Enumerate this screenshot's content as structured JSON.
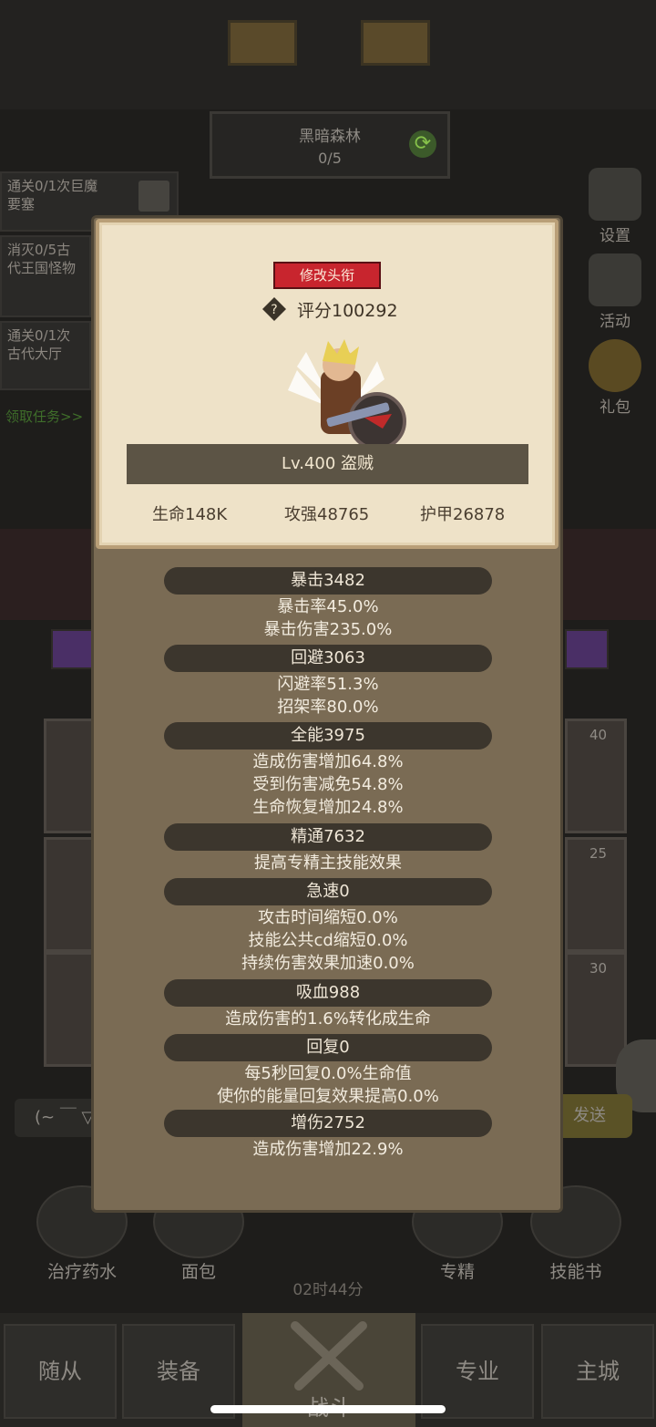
{
  "stage": {
    "name": "黑暗森林",
    "progress": "0/5"
  },
  "quests": [
    {
      "text": "通关0/1次巨魔要塞"
    },
    {
      "text": "消灭0/5古代王国怪物"
    },
    {
      "text": "通关0/1次古代大厅"
    }
  ],
  "quest_link": "领取任务>>",
  "side_menu": [
    {
      "label": "设置",
      "icon": "gear-icon"
    },
    {
      "label": "活动",
      "icon": "activity-icon"
    },
    {
      "label": "礼包",
      "icon": "gift-icon"
    }
  ],
  "card_numbers": [
    "40",
    "25",
    "30"
  ],
  "chat_placeholder": "(~ ￣ ▽",
  "send_label": "发送",
  "items": [
    {
      "label": "治疗药水",
      "icon": "potion-icon"
    },
    {
      "label": "面包",
      "icon": "bread-icon"
    },
    {
      "label": "专精",
      "icon": "specialization-icon"
    },
    {
      "label": "技能书",
      "icon": "skillbook-icon"
    }
  ],
  "timer": "02时44分",
  "tabs": [
    {
      "label": "随从"
    },
    {
      "label": "装备"
    },
    {
      "label": "战斗"
    },
    {
      "label": "专业"
    },
    {
      "label": "主城"
    }
  ],
  "profile": {
    "edit_title_button": "修改头衔",
    "score": "评分100292",
    "level_class": "Lv.400 盗贼",
    "hp": "生命148K",
    "attack": "攻强48765",
    "armor": "护甲26878"
  },
  "stats": [
    {
      "header": "暴击3482",
      "lines": [
        "暴击率45.0%",
        "暴击伤害235.0%"
      ]
    },
    {
      "header": "回避3063",
      "lines": [
        "闪避率51.3%",
        "招架率80.0%"
      ]
    },
    {
      "header": "全能3975",
      "lines": [
        "造成伤害增加64.8%",
        "受到伤害减免54.8%",
        "生命恢复增加24.8%"
      ]
    },
    {
      "header": "精通7632",
      "lines": [
        "提高专精主技能效果"
      ]
    },
    {
      "header": "急速0",
      "lines": [
        "攻击时间缩短0.0%",
        "技能公共cd缩短0.0%",
        "持续伤害效果加速0.0%"
      ]
    },
    {
      "header": "吸血988",
      "lines": [
        "造成伤害的1.6%转化成生命"
      ]
    },
    {
      "header": "回复0",
      "lines": [
        "每5秒回复0.0%生命值",
        "使你的能量回复效果提高0.0%"
      ]
    },
    {
      "header": "增伤2752",
      "lines": [
        "造成伤害增加22.9%"
      ]
    }
  ]
}
